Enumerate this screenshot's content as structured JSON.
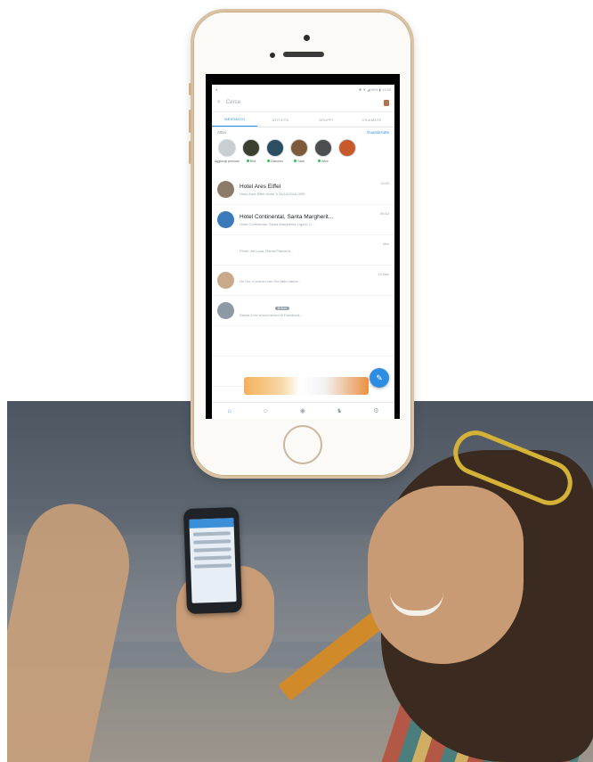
{
  "phone": {
    "status_time": "13:59",
    "status_icons": "✱ ▼ ◢ 85% ▮",
    "search_text": "Cerca",
    "tabs": [
      {
        "label": "MESSAGGI",
        "active": true
      },
      {
        "label": "ATTIVITÀ",
        "active": false
      },
      {
        "label": "GRUPPI",
        "active": false
      },
      {
        "label": "CHIAMATE",
        "active": false
      }
    ],
    "active_label": "Attivi",
    "see_all_label": "Guarda tutte",
    "stories": [
      {
        "name": "Aggiungi persone",
        "online": false,
        "color": "#c9ced3"
      },
      {
        "name": "Rita",
        "online": true,
        "color": "#3a3f2f"
      },
      {
        "name": "Giacomo",
        "online": true,
        "color": "#2c4e62"
      },
      {
        "name": "Sara",
        "online": true,
        "color": "#7c5a3b"
      },
      {
        "name": "Alice",
        "online": true,
        "color": "#4b4f52"
      },
      {
        "name": "",
        "online": false,
        "color": "#c85a2a"
      }
    ],
    "conversations": [
      {
        "title": "Hotel Ares Eiffel",
        "subtitle": "Hotel Ares Eiffel Hotel: Il 26/10/2016 ORE",
        "time": "10:53",
        "avatar_color": "#8d7b6a",
        "tag": ""
      },
      {
        "title": "Hotel Continental, Santa Margherit...",
        "subtitle": "Hotel Continental, Santa Margherita Ligure: C...",
        "time": "09:42",
        "avatar_color": "#3a7ab8",
        "tag": ""
      },
      {
        "title": "",
        "subtitle": "Photo        Via Luca, Roma Piazza N...",
        "time": "Mer",
        "avatar_color": "#ffffff",
        "tag": ""
      },
      {
        "title": "",
        "subtitle": "Ho l'ho, il pranzo non l'ho fatto hanno...",
        "time": "13 Nov",
        "avatar_color": "#caa98a",
        "tag": ""
      },
      {
        "title": "",
        "subtitle": "Saluta il tuo nuovo amico di Facebook...",
        "time": "",
        "avatar_color": "#8d9aa5",
        "tag": "8 Ann"
      },
      {
        "title": "",
        "subtitle": "",
        "time": "",
        "avatar_color": "#ffffff",
        "tag": ""
      },
      {
        "title": "",
        "subtitle": "",
        "time": "",
        "avatar_color": "#ffffff",
        "tag": ""
      }
    ],
    "nav_icons": [
      "home-icon",
      "people-icon",
      "camera-icon",
      "games-icon",
      "settings-icon"
    ],
    "accent": "#2d8de0"
  }
}
